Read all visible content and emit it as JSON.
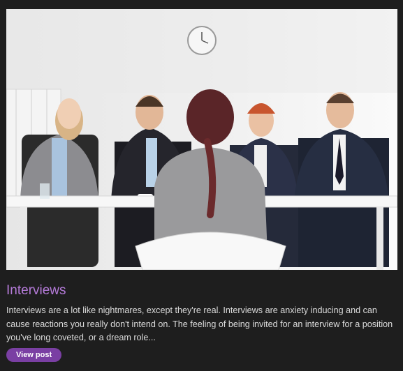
{
  "post": {
    "title": "Interviews",
    "excerpt": "Interviews are a lot like nightmares, except they're real. Interviews are anxiety inducing and can cause reactions you really don't intend on. The feeling of being invited for an interview for a position you've long coveted, or a dream role...",
    "button_label": "View post",
    "image_subject": "job interview panel photo"
  },
  "colors": {
    "page_background": "#1e1e1e",
    "title": "#b57bd9",
    "text": "#dcdcdc",
    "button": "#7a3fa3"
  }
}
